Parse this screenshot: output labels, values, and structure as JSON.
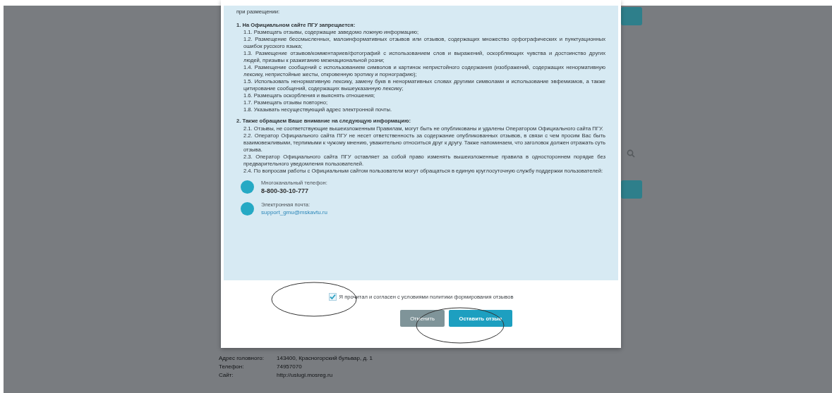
{
  "modal": {
    "intro": "при размещении:",
    "sections": [
      {
        "title": "1. На Официальном сайте ПГУ запрещается:",
        "items": [
          "1.1. Размещать отзывы, содержащие заведомо ложную информацию;",
          "1.2. Размещение бессмысленных, малоинформативных отзывов или отзывов, содержащих множество орфографических и пунктуационных ошибок русского языка;",
          "1.3. Размещение отзывов/комментариев/фотографий с использованием слов и выражений, оскорбляющих чувства и достоинство других людей, призывы к разжиганию межнациональной розни;",
          "1.4. Размещение сообщений с использованием символов и картинок непристойного содержания (изображений, содержащих ненормативную лексику, непристойные жесты, откровенную эротику и порнографию);",
          "1.5. Использовать ненормативную лексику, замену букв в ненормативных словах другими символами и использование эвфемизмов, а также цитирование сообщений, содержащих вышеуказанную лексику;",
          "1.6. Размещать оскорбления и выяснять отношения;",
          "1.7. Размещать отзывы повторно;",
          "1.8. Указывать несуществующий адрес электронной почты."
        ]
      },
      {
        "title": "2. Также обращаем Ваше внимание на следующую информацию:",
        "items": [
          "2.1. Отзывы, не соответствующие вышеизложенным Правилам, могут быть не опубликованы и удалены Оператором Официального сайта ПГУ.",
          "2.2. Оператор Официального сайта ПГУ не несет ответственность за содержание опубликованных отзывов, в связи с чем просим Вас быть взаимовежливыми, терпимыми к чужому мнению, уважительно относиться друг к другу. Также напоминаем, что заголовок должен отражать суть отзыва.",
          "2.3. Оператор Официального сайта ПГУ оставляет за собой право изменять вышеизложенные правила в одностороннем порядке без предварительного уведомления пользователей.",
          "2.4. По вопросам работы с Официальным сайтом пользователи могут обращаться в единую круглосуточную службу поддержки пользователей:"
        ]
      }
    ],
    "contacts": [
      {
        "kind": "phone",
        "label": "Многоканальный телефон:",
        "value": "8-800-30-10-777"
      },
      {
        "kind": "email",
        "label": "Электронная почта:",
        "value": "support_gmu@mskavtu.ru"
      }
    ],
    "consent": {
      "label": "Я прочитал и согласен с условиями политики формирования отзывов",
      "checked": true
    },
    "buttons": [
      {
        "label": "Отменить",
        "kind": "secondary"
      },
      {
        "label": "Оставить отзыв",
        "kind": "primary"
      }
    ]
  },
  "page_footer": [
    {
      "label": "Адрес головного:",
      "value": "143400, Красногорский бульвар, д. 1"
    },
    {
      "label": "Телефон:",
      "value": "74957070"
    },
    {
      "label": "Сайт:",
      "value": "http://uslugi.mosreg.ru"
    }
  ]
}
